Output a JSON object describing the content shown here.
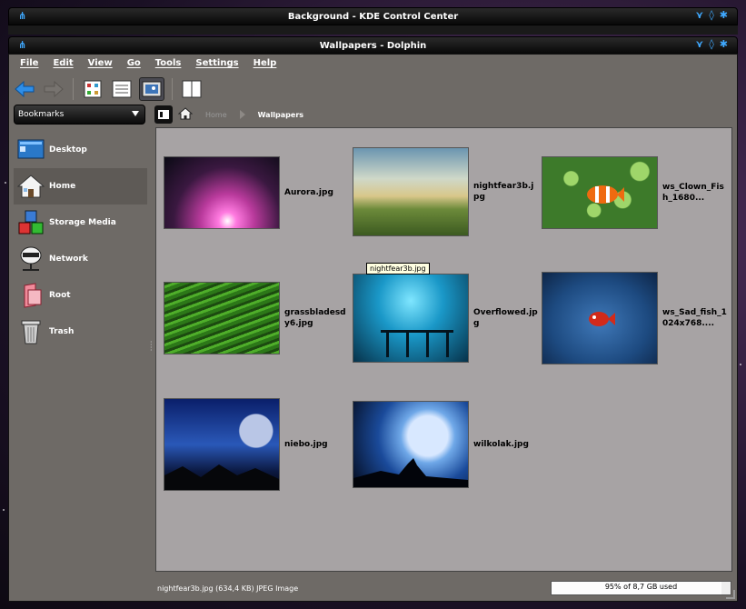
{
  "outer_window": {
    "title": "Background - KDE Control Center"
  },
  "window": {
    "title": "Wallpapers - Dolphin"
  },
  "menu": [
    "File",
    "Edit",
    "View",
    "Go",
    "Tools",
    "Settings",
    "Help"
  ],
  "toolbar": {
    "buttons": [
      "back-icon",
      "forward-icon",
      "icon-view-icon",
      "details-view-icon",
      "preview-icon",
      "split-view-icon"
    ]
  },
  "sidebar": {
    "selector_label": "Bookmarks",
    "places": [
      {
        "label": "Desktop",
        "icon": "desktop-icon"
      },
      {
        "label": "Home",
        "icon": "home-icon"
      },
      {
        "label": "Storage Media",
        "icon": "storage-icon"
      },
      {
        "label": "Network",
        "icon": "network-icon"
      },
      {
        "label": "Root",
        "icon": "root-icon"
      },
      {
        "label": "Trash",
        "icon": "trash-icon"
      }
    ]
  },
  "breadcrumb": {
    "home": "Home",
    "current": "Wallpapers"
  },
  "files": [
    {
      "name": "Aurora.jpg"
    },
    {
      "name": "nightfear3b.jpg"
    },
    {
      "name": "ws_Clown_Fish_1680..."
    },
    {
      "name": "grassbladesdy6.jpg"
    },
    {
      "name": "Overflowed.jpg"
    },
    {
      "name": "ws_Sad_fish_1024x768...."
    },
    {
      "name": "niebo.jpg"
    },
    {
      "name": "wilkolak.jpg"
    }
  ],
  "tooltip": "nightfear3b.jpg",
  "status": {
    "text": "nightfear3b.jpg (634,4 KB)  JPEG Image",
    "space_label": "95% of 8,7 GB used",
    "space_used": 0.95
  },
  "colors": {
    "accent": "#3fa9ff",
    "window_bg": "#6e6a66",
    "content_bg": "#a7a3a4"
  }
}
